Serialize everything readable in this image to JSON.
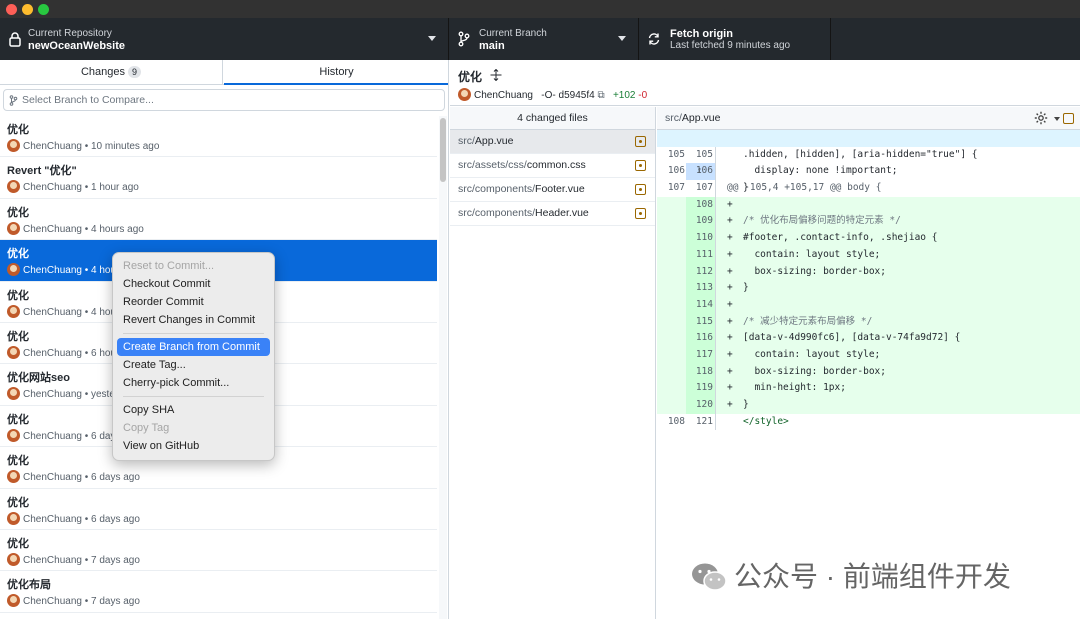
{
  "toolbar": {
    "repo_label": "Current Repository",
    "repo_name": "newOceanWebsite",
    "branch_label": "Current Branch",
    "branch_name": "main",
    "fetch_label": "Fetch origin",
    "fetch_status": "Last fetched 9 minutes ago"
  },
  "tabs": {
    "changes": "Changes",
    "changes_count": "9",
    "history": "History"
  },
  "compare": {
    "placeholder": "Select Branch to Compare..."
  },
  "commits": [
    {
      "message": "优化",
      "author": "ChenChuang",
      "time": "10 minutes ago"
    },
    {
      "message": "Revert \"优化\"",
      "author": "ChenChuang",
      "time": "1 hour ago"
    },
    {
      "message": "优化",
      "author": "ChenChuang",
      "time": "4 hours ago"
    },
    {
      "message": "优化",
      "author": "ChenChuang",
      "time": "4 hou"
    },
    {
      "message": "优化",
      "author": "ChenChuang",
      "time": "4 hou"
    },
    {
      "message": "优化",
      "author": "ChenChuang",
      "time": "6 hou"
    },
    {
      "message": "优化网站seo",
      "author": "ChenChuang",
      "time": "yeste"
    },
    {
      "message": "优化",
      "author": "ChenChuang",
      "time": "6 day"
    },
    {
      "message": "优化",
      "author": "ChenChuang",
      "time": "6 days ago"
    },
    {
      "message": "优化",
      "author": "ChenChuang",
      "time": "6 days ago"
    },
    {
      "message": "优化",
      "author": "ChenChuang",
      "time": "7 days ago"
    },
    {
      "message": "优化布局",
      "author": "ChenChuang",
      "time": "7 days ago"
    }
  ],
  "context_menu": {
    "reset": "Reset to Commit...",
    "checkout": "Checkout Commit",
    "reorder": "Reorder Commit",
    "revert": "Revert Changes in Commit",
    "create_branch": "Create Branch from Commit",
    "create_tag": "Create Tag...",
    "cherry_pick": "Cherry-pick Commit...",
    "copy_sha": "Copy SHA",
    "copy_tag": "Copy Tag",
    "view_github": "View on GitHub"
  },
  "commit_detail": {
    "title": "优化",
    "author": "ChenChuang",
    "sha": "d5945f4",
    "additions": "+102",
    "deletions": "-0"
  },
  "files": {
    "header": "4 changed files",
    "items": [
      {
        "dir": "src/",
        "name": "App.vue"
      },
      {
        "dir": "src/assets/css/",
        "name": "common.css"
      },
      {
        "dir": "src/components/",
        "name": "Footer.vue"
      },
      {
        "dir": "src/components/",
        "name": "Header.vue"
      }
    ]
  },
  "diff": {
    "dir": "src/",
    "name": "App.vue",
    "hunk": "@@ -105,4 +105,17 @@ body {",
    "lines": [
      {
        "old": "105",
        "new": "105",
        "sign": "",
        "text": ".hidden, [hidden], [aria-hidden=\"true\"] {"
      },
      {
        "old": "106",
        "new": "106",
        "sign": "",
        "text": "  display: none !important;"
      },
      {
        "old": "107",
        "new": "107",
        "sign": "",
        "text": "}"
      },
      {
        "old": "",
        "new": "108",
        "sign": "+",
        "text": ""
      },
      {
        "old": "",
        "new": "109",
        "sign": "+",
        "text": "/* 优化布局偏移问题的特定元素 */"
      },
      {
        "old": "",
        "new": "110",
        "sign": "+",
        "text": "#footer, .contact-info, .shejiao {"
      },
      {
        "old": "",
        "new": "111",
        "sign": "+",
        "text": "  contain: layout style;"
      },
      {
        "old": "",
        "new": "112",
        "sign": "+",
        "text": "  box-sizing: border-box;"
      },
      {
        "old": "",
        "new": "113",
        "sign": "+",
        "text": "}"
      },
      {
        "old": "",
        "new": "114",
        "sign": "+",
        "text": ""
      },
      {
        "old": "",
        "new": "115",
        "sign": "+",
        "text": "/* 减少特定元素布局偏移 */"
      },
      {
        "old": "",
        "new": "116",
        "sign": "+",
        "text": "[data-v-4d990fc6], [data-v-74fa9d72] {"
      },
      {
        "old": "",
        "new": "117",
        "sign": "+",
        "text": "  contain: layout style;"
      },
      {
        "old": "",
        "new": "118",
        "sign": "+",
        "text": "  box-sizing: border-box;"
      },
      {
        "old": "",
        "new": "119",
        "sign": "+",
        "text": "  min-height: 1px;"
      },
      {
        "old": "",
        "new": "120",
        "sign": "+",
        "text": "}"
      },
      {
        "old": "108",
        "new": "121",
        "sign": "",
        "text": "</style>"
      }
    ]
  },
  "watermark": "公众号 · 前端组件开发",
  "colors": {
    "accent": "#0969da",
    "added": "#1a7f37",
    "removed": "#cf222e",
    "menu_highlight": "#3a82f7"
  }
}
